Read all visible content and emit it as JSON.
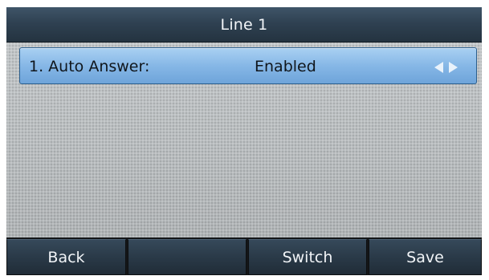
{
  "title": "Line 1",
  "setting": {
    "label": "1. Auto Answer:",
    "value": "Enabled",
    "left_arrow_icon": "arrow-left-icon",
    "right_arrow_icon": "arrow-right-icon"
  },
  "softkeys": [
    {
      "label": "Back"
    },
    {
      "label": ""
    },
    {
      "label": "Switch"
    },
    {
      "label": "Save"
    }
  ],
  "colors": {
    "title_bar": "#2f4152",
    "highlight_row": "#86b7e6",
    "background": "#b9bdbf",
    "softkey": "#2a3a48",
    "text_light": "#f1f4f7"
  }
}
